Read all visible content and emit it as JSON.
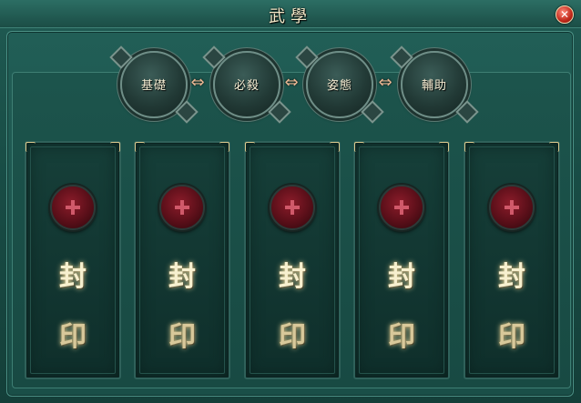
{
  "window": {
    "title": "武學",
    "close_label": "✕"
  },
  "tabs": [
    {
      "label": "基礎"
    },
    {
      "label": "必殺"
    },
    {
      "label": "姿態"
    },
    {
      "label": "輔助"
    }
  ],
  "arrow_glyph": "⇔",
  "slots": [
    {
      "line1": "封",
      "line2": "印"
    },
    {
      "line1": "封",
      "line2": "印"
    },
    {
      "line1": "封",
      "line2": "印"
    },
    {
      "line1": "封",
      "line2": "印"
    },
    {
      "line1": "封",
      "line2": "印"
    }
  ],
  "colors": {
    "background": "#1b4d46",
    "seal_orb": "#8c1c2a",
    "seal_text": "#f7f0cf"
  }
}
